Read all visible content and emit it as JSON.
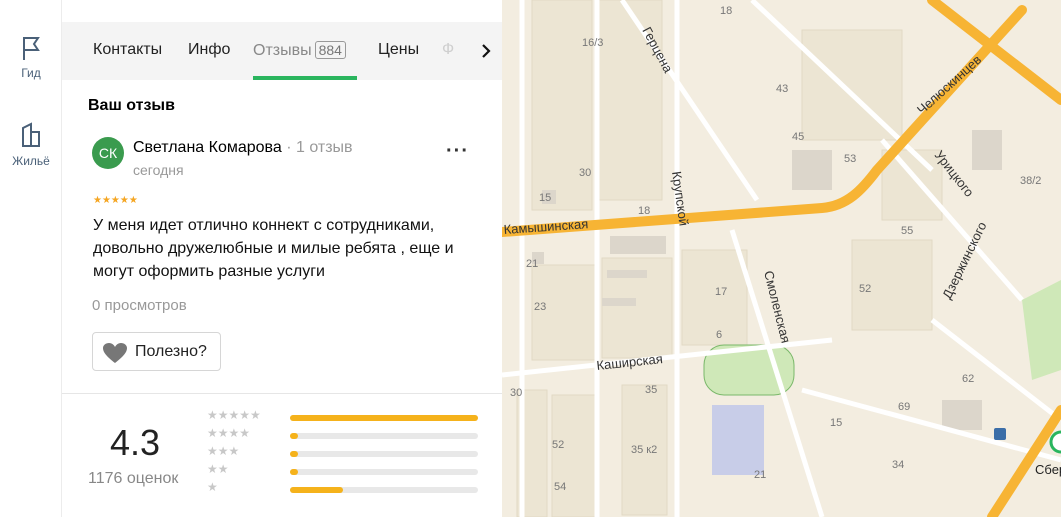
{
  "rail": {
    "items": [
      {
        "label": "Гид",
        "icon": "flag-icon"
      },
      {
        "label": "Жильё",
        "icon": "building-icon"
      }
    ]
  },
  "tabs": {
    "items": [
      "Контакты",
      "Инфо",
      "Отзывы",
      "Цены"
    ],
    "active": "Отзывы",
    "reviews_count": "884",
    "faded_next": "Ф"
  },
  "my_review": {
    "section_title": "Ваш отзыв",
    "avatar_initials": "СК",
    "author": "Светлана Комарова",
    "author_meta": "1 отзыв",
    "date": "сегодня",
    "stars": "★★★★★",
    "rating": 5,
    "text": "У меня идет отлично коннект с сотрудниками, довольно дружелюбные и милые ребята , еще и могут оформить разные услуги",
    "views": "0 просмотров",
    "useful_label": "Полезно?"
  },
  "summary": {
    "rating": "4.3",
    "count_label": "1176 оценок",
    "distribution": [
      {
        "stars": "★★★★★",
        "fraction": 1.0
      },
      {
        "stars": "★★★★",
        "fraction": 0.04
      },
      {
        "stars": "★★★",
        "fraction": 0.04
      },
      {
        "stars": "★★",
        "fraction": 0.04
      },
      {
        "stars": "★",
        "fraction": 0.28
      }
    ]
  },
  "map": {
    "streets": [
      "Камышинская",
      "Герцена",
      "Крупской",
      "Смоленская",
      "Каширская",
      "Челюскинцев",
      "Урицкого",
      "Дзержинского"
    ],
    "house_numbers": [
      "18",
      "16/3",
      "43",
      "45",
      "53",
      "38/2",
      "30",
      "18",
      "15",
      "21",
      "55",
      "52",
      "23",
      "17",
      "6",
      "30",
      "35",
      "62",
      "69",
      "52",
      "35 к2",
      "15",
      "54",
      "21",
      "34"
    ],
    "poi_label": "Сбер",
    "colors": {
      "road": "#f7b434",
      "land": "#f3ede0",
      "block": "#ece5d3",
      "green": "#cfe8b8"
    }
  }
}
